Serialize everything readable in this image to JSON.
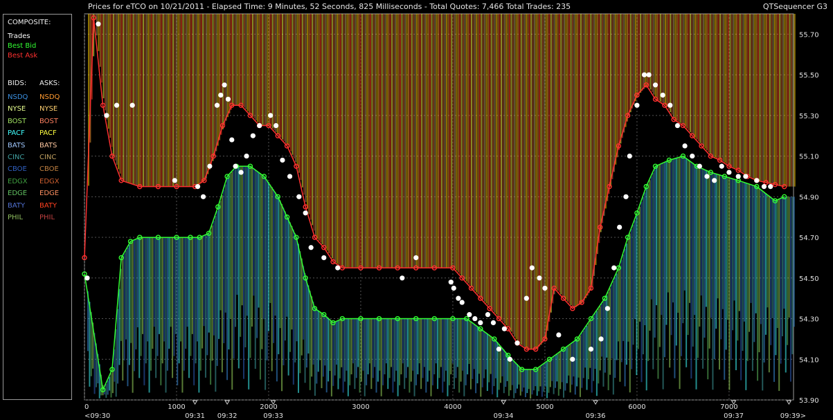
{
  "header": {
    "title": "Prices for  eTCO  on  10/21/2011  -  Elapsed Time: 9 Minutes, 52 Seconds, 825 Milliseconds  -  Total Quotes: 7,466  Total Trades: 235",
    "brand": "QTSequencer G3"
  },
  "legend": {
    "composite_label": "COMPOSITE:",
    "composite": [
      {
        "label": "Trades",
        "color": "#ffffff"
      },
      {
        "label": "Best Bid",
        "color": "#33ff33"
      },
      {
        "label": "Best Ask",
        "color": "#ff3030"
      }
    ],
    "bids_label": "BIDS:",
    "asks_label": "ASKS:",
    "exchanges": [
      {
        "bid": "NSDQ",
        "bid_color": "#3a8fe0",
        "ask": "NSDQ",
        "ask_color": "#ff9a30"
      },
      {
        "bid": "NYSE",
        "bid_color": "#e8ff90",
        "ask": "NYSE",
        "ask_color": "#ffd070"
      },
      {
        "bid": "BOST",
        "bid_color": "#a0e060",
        "ask": "BOST",
        "ask_color": "#ff8060"
      },
      {
        "bid": "PACF",
        "bid_color": "#40ffff",
        "ask": "PACF",
        "ask_color": "#ffff40"
      },
      {
        "bid": "BATS",
        "bid_color": "#a0c8ff",
        "ask": "BATS",
        "ask_color": "#ffc8a0"
      },
      {
        "bid": "CINC",
        "bid_color": "#40a0a0",
        "ask": "CINC",
        "ask_color": "#c0a060"
      },
      {
        "bid": "CBOE",
        "bid_color": "#3060c0",
        "ask": "CBOE",
        "ask_color": "#c08040"
      },
      {
        "bid": "EDGX",
        "bid_color": "#40a040",
        "ask": "EDGX",
        "ask_color": "#d06030"
      },
      {
        "bid": "EDGE",
        "bid_color": "#60c060",
        "ask": "EDGE",
        "ask_color": "#ff9060"
      },
      {
        "bid": "BATY",
        "bid_color": "#5070d0",
        "ask": "BATY",
        "ask_color": "#ff4020"
      },
      {
        "bid": "PHIL",
        "bid_color": "#90c060",
        "ask": "PHIL",
        "ask_color": "#c04040"
      }
    ]
  },
  "chart_data": {
    "type": "line",
    "xlim": [
      0,
      7700
    ],
    "ylim": [
      53.9,
      55.8
    ],
    "x_ticks": [
      0,
      1000,
      2000,
      3000,
      4000,
      5000,
      6000,
      7000
    ],
    "x_tick_labels": [
      "0",
      "1000",
      "2000",
      "3000",
      "4000",
      "5000",
      "6000",
      "7000"
    ],
    "time_ticks": [
      {
        "x": -50,
        "label": "<09:30"
      },
      {
        "x": 1200,
        "label": "09:31"
      },
      {
        "x": 1550,
        "label": "09:32"
      },
      {
        "x": 2050,
        "label": "09:33"
      },
      {
        "x": 4550,
        "label": "09:34"
      },
      {
        "x": 5550,
        "label": "09:36"
      },
      {
        "x": 7050,
        "label": "09:37"
      },
      {
        "x": 7650,
        "label": "09:39>"
      }
    ],
    "y_ticks": [
      53.9,
      54.1,
      54.3,
      54.5,
      54.7,
      54.9,
      55.1,
      55.3,
      55.5,
      55.7
    ],
    "y_tick_labels": [
      "53.90",
      "54.10",
      "54.30",
      "54.50",
      "54.70",
      "54.90",
      "55.10",
      "55.30",
      "55.50",
      "55.70"
    ],
    "grid": true,
    "series": [
      {
        "name": "Best Bid",
        "color": "#33ff33",
        "x": [
          0,
          200,
          300,
          400,
          500,
          600,
          800,
          1000,
          1150,
          1250,
          1350,
          1450,
          1550,
          1650,
          1800,
          1950,
          2100,
          2200,
          2300,
          2400,
          2500,
          2600,
          2700,
          2800,
          3000,
          3200,
          3400,
          3600,
          3800,
          4000,
          4150,
          4300,
          4450,
          4600,
          4750,
          4900,
          5050,
          5200,
          5350,
          5500,
          5650,
          5800,
          5900,
          6000,
          6100,
          6200,
          6350,
          6500,
          6650,
          6800,
          6950,
          7100,
          7300,
          7500,
          7600
        ],
        "y": [
          54.52,
          53.95,
          54.05,
          54.6,
          54.68,
          54.7,
          54.7,
          54.7,
          54.7,
          54.7,
          54.72,
          54.85,
          55.0,
          55.05,
          55.05,
          55.0,
          54.9,
          54.8,
          54.7,
          54.5,
          54.35,
          54.32,
          54.28,
          54.3,
          54.3,
          54.3,
          54.3,
          54.3,
          54.3,
          54.3,
          54.3,
          54.25,
          54.2,
          54.12,
          54.05,
          54.05,
          54.1,
          54.15,
          54.2,
          54.3,
          54.4,
          54.55,
          54.7,
          54.82,
          54.95,
          55.05,
          55.08,
          55.1,
          55.05,
          55.02,
          55.0,
          54.98,
          54.95,
          54.88,
          54.9
        ]
      },
      {
        "name": "Best Ask",
        "color": "#ff3030",
        "x": [
          0,
          100,
          200,
          300,
          400,
          600,
          800,
          1000,
          1200,
          1300,
          1400,
          1500,
          1600,
          1700,
          1800,
          1900,
          2000,
          2100,
          2200,
          2300,
          2400,
          2500,
          2600,
          2700,
          2800,
          3000,
          3200,
          3400,
          3600,
          3800,
          4000,
          4100,
          4200,
          4300,
          4400,
          4500,
          4600,
          4700,
          4800,
          4900,
          5000,
          5100,
          5200,
          5300,
          5400,
          5500,
          5600,
          5700,
          5800,
          5900,
          6000,
          6100,
          6200,
          6300,
          6400,
          6500,
          6600,
          6700,
          6800,
          6900,
          7000,
          7100,
          7200,
          7300,
          7400,
          7500,
          7600
        ],
        "y": [
          54.6,
          55.78,
          55.35,
          55.1,
          54.98,
          54.95,
          54.95,
          54.95,
          54.95,
          54.98,
          55.1,
          55.25,
          55.35,
          55.35,
          55.3,
          55.25,
          55.25,
          55.2,
          55.15,
          55.05,
          54.85,
          54.7,
          54.65,
          54.58,
          54.55,
          54.55,
          54.55,
          54.55,
          54.55,
          54.55,
          54.55,
          54.5,
          54.45,
          54.4,
          54.35,
          54.3,
          54.25,
          54.18,
          54.15,
          54.15,
          54.2,
          54.45,
          54.4,
          54.35,
          54.38,
          54.45,
          54.75,
          54.95,
          55.15,
          55.3,
          55.4,
          55.45,
          55.38,
          55.35,
          55.28,
          55.25,
          55.2,
          55.15,
          55.1,
          55.08,
          55.05,
          55.03,
          55.0,
          54.98,
          54.97,
          54.96,
          54.95
        ]
      },
      {
        "name": "Trades",
        "color": "#ffffff",
        "x": [
          30,
          150,
          240,
          350,
          520,
          980,
          1230,
          1290,
          1360,
          1440,
          1480,
          1520,
          1560,
          1600,
          1640,
          1700,
          1760,
          1830,
          1900,
          2020,
          2080,
          2150,
          2230,
          2330,
          2400,
          2460,
          2600,
          2750,
          3450,
          3600,
          3980,
          4010,
          4060,
          4100,
          4180,
          4240,
          4300,
          4380,
          4440,
          4500,
          4560,
          4620,
          4700,
          4800,
          4860,
          4940,
          5000,
          5150,
          5300,
          5500,
          5610,
          5680,
          5750,
          5810,
          5880,
          5920,
          6000,
          6080,
          6130,
          6200,
          6280,
          6360,
          6440,
          6520,
          6600,
          6680,
          6760,
          6840,
          6920,
          7000,
          7100,
          7180,
          7300,
          7380,
          7450
        ],
        "y": [
          54.5,
          55.75,
          55.3,
          55.35,
          55.35,
          54.98,
          54.95,
          54.9,
          55.05,
          55.35,
          55.4,
          55.45,
          55.38,
          55.18,
          55.05,
          55.02,
          55.1,
          55.2,
          55.25,
          55.3,
          55.25,
          55.08,
          55.0,
          54.9,
          54.82,
          54.65,
          54.6,
          54.55,
          54.5,
          54.6,
          54.48,
          54.45,
          54.4,
          54.38,
          54.32,
          54.3,
          54.28,
          54.32,
          54.28,
          54.15,
          54.25,
          54.1,
          54.18,
          54.4,
          54.55,
          54.5,
          54.45,
          54.22,
          54.1,
          54.15,
          54.2,
          54.35,
          54.55,
          54.75,
          54.9,
          55.1,
          55.35,
          55.5,
          55.5,
          55.45,
          55.4,
          55.35,
          55.25,
          55.15,
          55.1,
          55.05,
          55.0,
          54.98,
          55.05,
          55.02,
          55.0,
          55.0,
          54.98,
          54.95,
          54.95
        ]
      }
    ],
    "markers": {
      "x_axis_triangles": [
        1200,
        1550,
        2050,
        4550,
        5550,
        7050,
        7650
      ]
    }
  }
}
